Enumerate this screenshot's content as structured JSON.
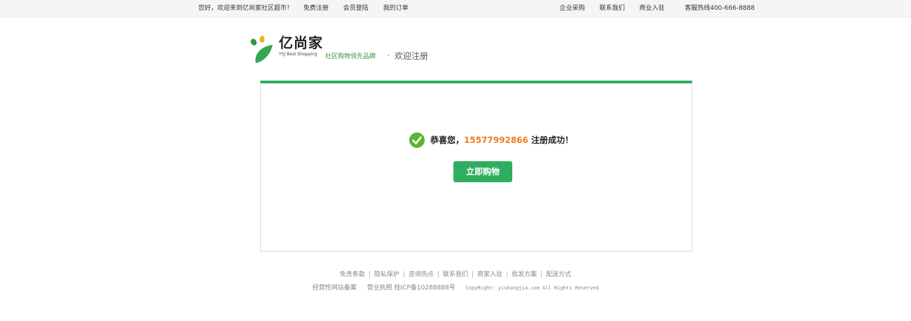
{
  "topbar": {
    "greeting": "您好，欢迎来到亿尚家社区超市！",
    "register": "免费注册",
    "login": "会员登陆",
    "orders": "我的订单",
    "enterprise": "企业采购",
    "contact": "联系我们",
    "merchant": "商业入驻",
    "hotline": "客服热线400-666-8888"
  },
  "header": {
    "brand_cn": "亿尚家",
    "brand_en": "YSJ Best Shopping",
    "slogan": "社区购物领先品牌",
    "page_title": "欢迎注册"
  },
  "result": {
    "prefix": "恭喜您，",
    "phone": "15577992866",
    "suffix": " 注册成功！",
    "button": "立即购物"
  },
  "footer": {
    "links": [
      "免责条款",
      "隐私保护",
      "咨询热点",
      "联系我们",
      "商家入驻",
      "批发方案",
      "配送方式"
    ],
    "separator": "|",
    "license1": "经营性网站备案",
    "license2": "营业执照 桂ICP备10288888号",
    "copyright": "CopyRight: yishangjia.com All Rights Reserved"
  },
  "colors": {
    "accent": "#2fae5f",
    "phone": "#f07b1f",
    "slogan": "#3d8f45"
  },
  "icons": {
    "logo": "leaf-logo-icon",
    "success": "check-circle-icon"
  }
}
